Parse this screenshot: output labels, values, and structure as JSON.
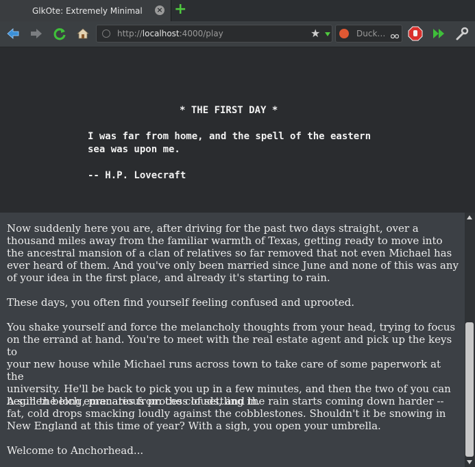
{
  "browser": {
    "tab": {
      "title": "GlkOte: Extremely Minimal",
      "close_glyph": "×"
    },
    "new_tab_glyph": "+",
    "url": {
      "scheme": "http://",
      "host": "localhost",
      "rest": ":4000/play"
    },
    "search": {
      "placeholder": "Duck…"
    },
    "icons": [
      "back-icon",
      "forward-icon",
      "reload-icon",
      "home-icon",
      "globe-icon",
      "bookmark-star-icon",
      "duckduckgo-icon",
      "search-glass-icon",
      "adblock-icon",
      "forward-double-icon",
      "wrench-icon"
    ],
    "colors": {
      "accent_green": "#4fc83f",
      "back_blue": "#3b8fd6",
      "stop_red": "#d9302c",
      "duck_orange": "#de5833"
    }
  },
  "header": {
    "title": "* THE FIRST DAY *",
    "quote_line1": "I was far from home, and the spell of the eastern",
    "quote_line2": "sea was upon me.",
    "attribution": "-- H.P. Lovecraft"
  },
  "story": {
    "paragraphs": [
      {
        "lines": [
          "Now suddenly here you are, after driving for the past two days straight, over a",
          "thousand miles away from the familiar warmth of Texas, getting ready to move into",
          "the ancestral mansion of a clan of relatives so far removed that not even Michael has",
          "ever heard of them. And you've only been married since June and none of this was any",
          "of your idea in the first place, and already it's starting to rain."
        ]
      },
      {
        "lines": [
          "These days, you often find yourself feeling confused and uprooted."
        ]
      },
      {
        "lines": [
          "You shake yourself and force the melancholy thoughts from your head, trying to focus",
          "on the errand at hand. You're to meet with the real estate agent and pick up the keys to",
          "your new house while Michael runs across town to take care of some paperwork at the",
          "university. He'll be back to pick you up in a few minutes, and then the two of you can",
          "begin the long, precarious process of settling in."
        ]
      },
      {
        "lines": [
          "A sullen belch emanates from the clouds, and the rain starts coming down harder --",
          "fat, cold drops smacking loudly against the cobblestones. Shouldn't it be snowing in",
          "New England at this time of year? With a sigh, you open your umbrella."
        ]
      },
      {
        "lines": [
          "Welcome to Anchorhead..."
        ]
      }
    ]
  }
}
